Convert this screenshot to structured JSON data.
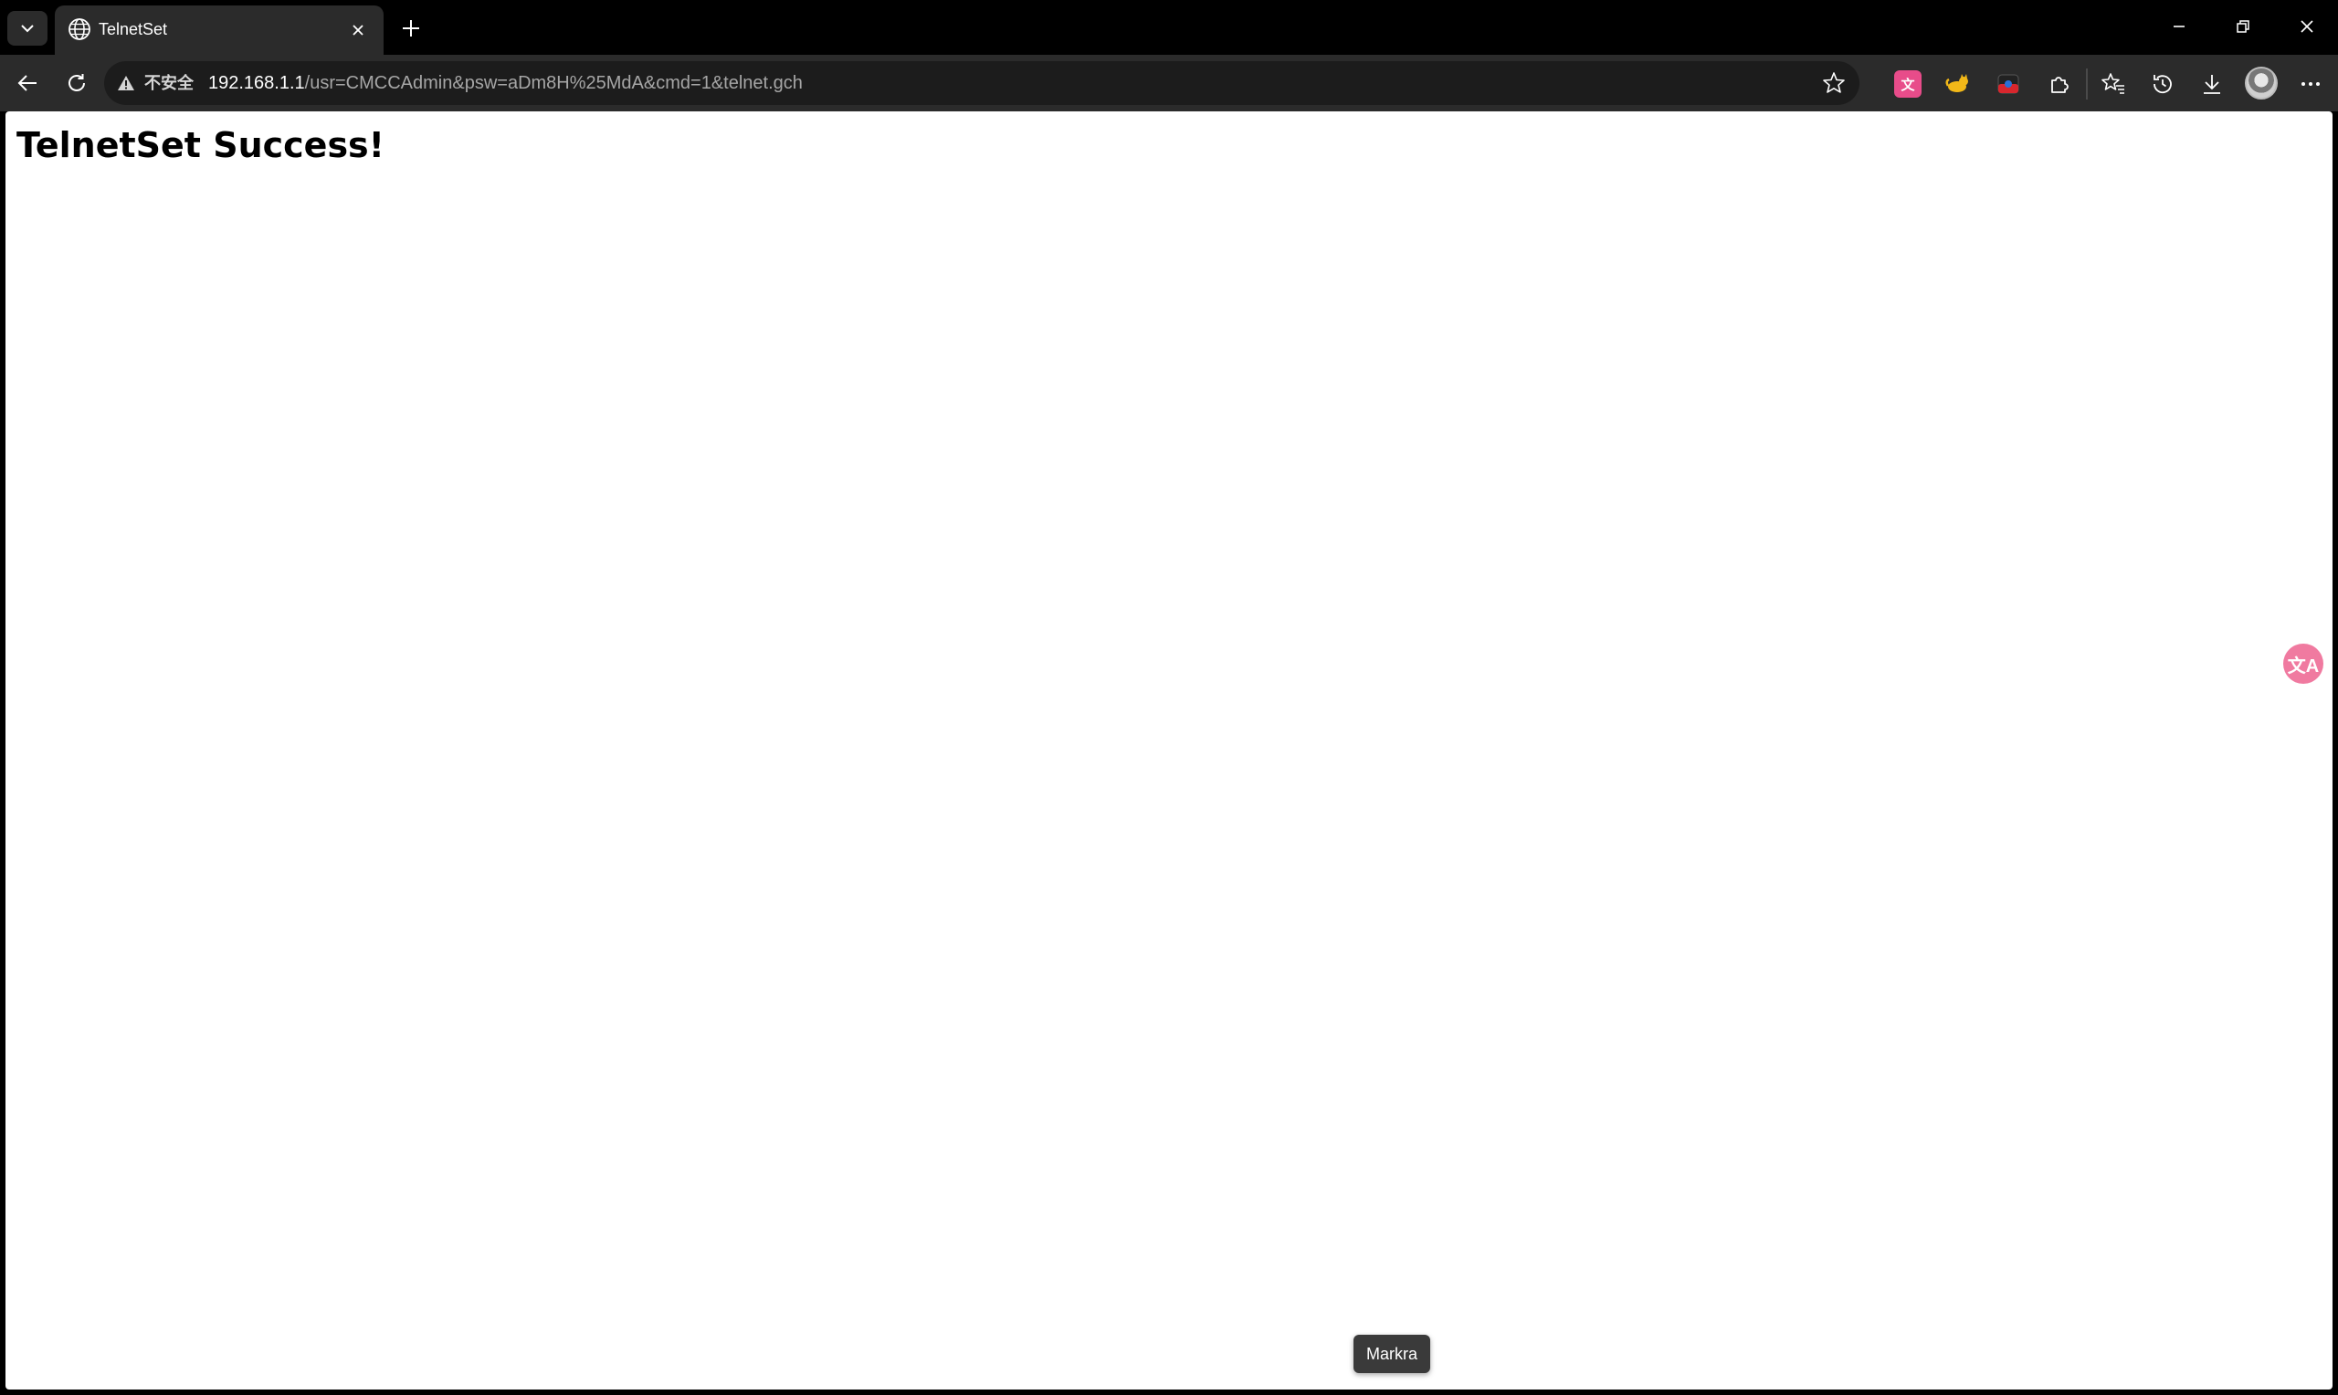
{
  "browser": {
    "tab": {
      "title": "TelnetSet"
    },
    "address_bar": {
      "security_label": "不安全",
      "url_host": "192.168.1.1",
      "url_path": "/usr=CMCCAdmin&psw=aDm8H%25MdA&cmd=1&telnet.gch"
    },
    "icons": {
      "tab_list": "chevron-down-icon",
      "favicon": "globe-icon",
      "tab_close": "close-icon",
      "new_tab": "plus-icon",
      "minimize": "minimize-icon",
      "restore": "restore-icon",
      "window_close": "close-icon",
      "back": "arrow-left-icon",
      "reload": "reload-icon",
      "not_secure": "warning-icon",
      "favorite": "star-icon",
      "extensions": "puzzle-icon",
      "favorites": "favorites-icon",
      "history": "history-icon",
      "downloads": "download-icon",
      "settings_menu": "more-icon"
    },
    "colors": {
      "chrome_bg": "#000000",
      "toolbar_bg": "#2b2b2b",
      "omnibox_bg": "#1c1c1c",
      "translate_accent": "#f07aa0"
    }
  },
  "page": {
    "heading": "TelnetSet Success!"
  },
  "translate_button": {
    "glyph": "文A"
  },
  "tooltip": {
    "text": "Markra"
  }
}
